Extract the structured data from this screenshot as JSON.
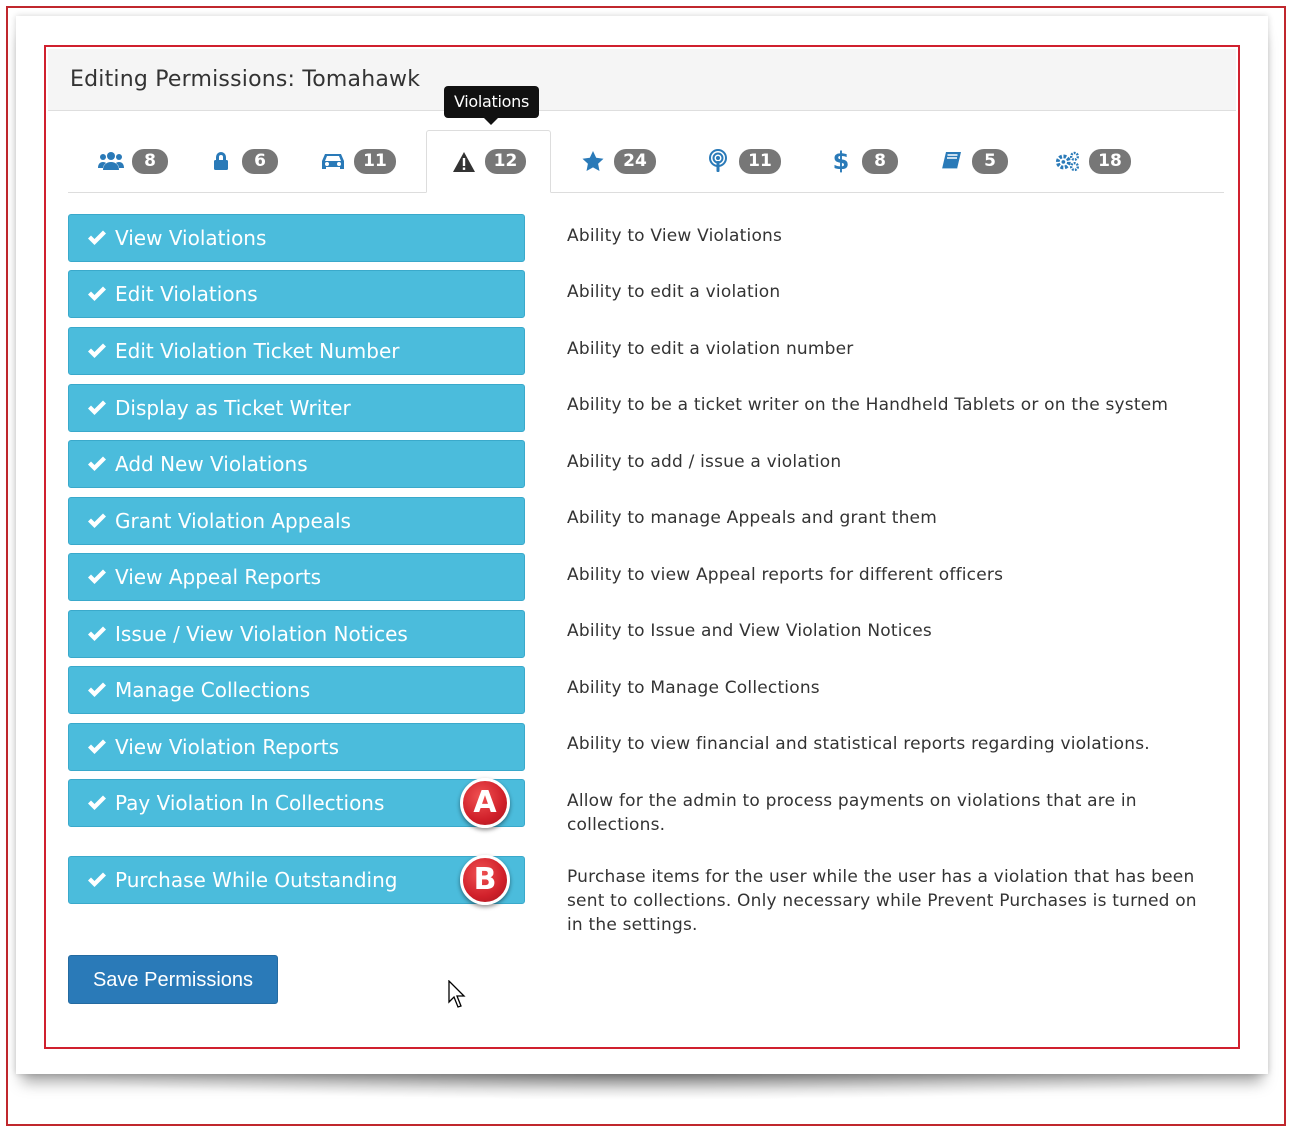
{
  "panel": {
    "title": "Editing Permissions: Tomahawk"
  },
  "tooltip": "Violations",
  "tabs": [
    {
      "icon": "users-icon",
      "count": "8"
    },
    {
      "icon": "lock-icon",
      "count": "6"
    },
    {
      "icon": "car-icon",
      "count": "11"
    },
    {
      "icon": "warning-icon",
      "count": "12",
      "active": true
    },
    {
      "icon": "star-icon",
      "count": "24"
    },
    {
      "icon": "podcast-icon",
      "count": "11"
    },
    {
      "icon": "dollar-icon",
      "count": "8"
    },
    {
      "icon": "book-icon",
      "count": "5"
    },
    {
      "icon": "cogs-icon",
      "count": "18"
    }
  ],
  "permissions": [
    {
      "label": "View Violations",
      "description": "Ability to View Violations"
    },
    {
      "label": "Edit Violations",
      "description": "Ability to edit a violation"
    },
    {
      "label": "Edit Violation Ticket Number",
      "description": "Ability to edit a violation number"
    },
    {
      "label": "Display as Ticket Writer",
      "description": "Ability to be a ticket writer on the Handheld Tablets or on the system"
    },
    {
      "label": "Add New Violations",
      "description": "Ability to add / issue a violation"
    },
    {
      "label": "Grant Violation Appeals",
      "description": "Ability to manage Appeals and grant them"
    },
    {
      "label": "View Appeal Reports",
      "description": "Ability to view Appeal reports for different officers"
    },
    {
      "label": "Issue / View Violation Notices",
      "description": "Ability to Issue and View Violation Notices"
    },
    {
      "label": "Manage Collections",
      "description": "Ability to Manage Collections"
    },
    {
      "label": "View Violation Reports",
      "description": "Ability to view financial and statistical reports regarding violations."
    },
    {
      "label": "Pay Violation In Collections",
      "description": "Allow for the admin to process payments on violations that are in collections.",
      "marker": "A"
    },
    {
      "label": "Purchase While Outstanding",
      "description": "Purchase items for the user while the user has a violation that has been sent to collections. Only necessary while Prevent Purchases is turned on in the settings.",
      "marker": "B"
    }
  ],
  "save_button": "Save Permissions",
  "colors": {
    "permission_button": "#4bbcdc",
    "save_button": "#2a7ab8",
    "badge": "#777777",
    "frame_red": "#d0202e",
    "tab_icon": "#2a7ab8"
  }
}
